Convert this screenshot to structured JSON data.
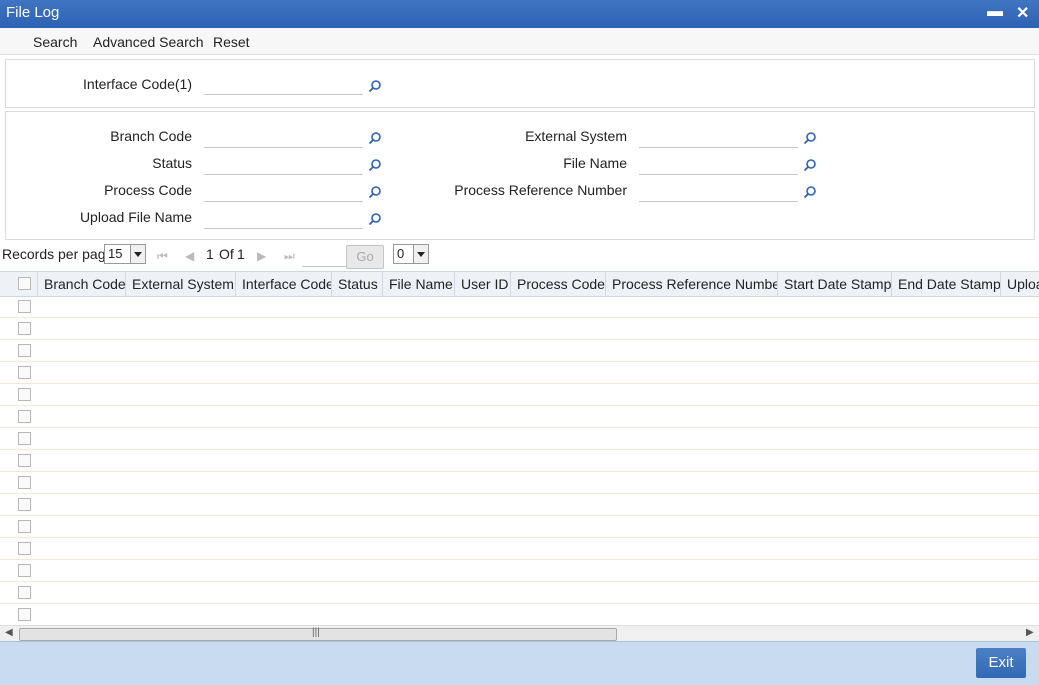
{
  "window": {
    "title": "File Log",
    "minimize_icon": "minimize-icon",
    "close_icon": "close-icon"
  },
  "menu": {
    "search": "Search",
    "advanced_search": "Advanced Search",
    "reset": "Reset"
  },
  "search_panel": {
    "interface_code_label": "Interface Code(1)",
    "branch_code_label": "Branch Code",
    "status_label": "Status",
    "process_code_label": "Process Code",
    "upload_file_name_label": "Upload File Name",
    "external_system_label": "External System",
    "file_name_label": "File Name",
    "process_reference_number_label": "Process Reference Number",
    "lookup_icon": "magnifier-icon"
  },
  "pager": {
    "records_per_page_label": "Records per page",
    "records_per_page_value": "15",
    "page_current": "1",
    "page_of": "Of",
    "page_total": "1",
    "go_label": "Go",
    "second_select_value": "0"
  },
  "grid": {
    "columns": [
      "Branch Code",
      "External System",
      "Interface Code",
      "Status",
      "File Name",
      "User ID",
      "Process Code",
      "Process Reference Number",
      "Start Date Stamp",
      "End Date Stamp",
      "Uploa"
    ],
    "row_count": 15
  },
  "footer": {
    "exit_label": "Exit"
  }
}
